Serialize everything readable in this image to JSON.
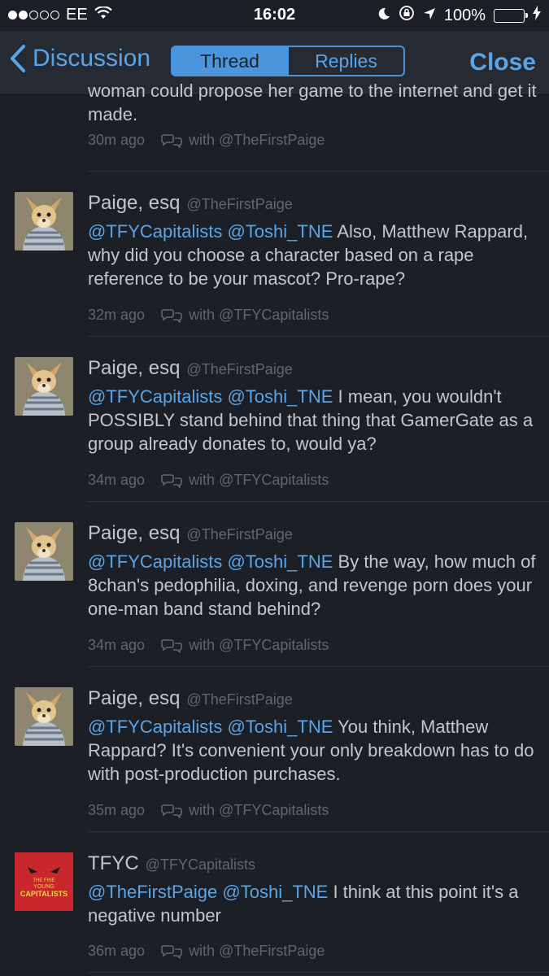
{
  "status_bar": {
    "carrier": "EE",
    "time": "16:02",
    "battery": "100%"
  },
  "nav": {
    "back_label": "Discussion",
    "tabs": [
      {
        "label": "Thread",
        "active": true
      },
      {
        "label": "Replies",
        "active": false
      }
    ],
    "close_label": "Close"
  },
  "partial_tweet": {
    "text": "woman could propose her game to the internet and get it made.",
    "time": "30m ago",
    "with": "with @TheFirstPaige"
  },
  "tweets": [
    {
      "name": "Paige, esq",
      "handle": "@TheFirstPaige",
      "mentions": "@TFYCapitalists @Toshi_TNE",
      "text": "Also, Matthew Rappard, why did you choose a character based on a rape reference to be your mascot? Pro-rape?",
      "time": "32m ago",
      "with": "with @TFYCapitalists"
    },
    {
      "name": "Paige, esq",
      "handle": "@TheFirstPaige",
      "mentions": "@TFYCapitalists @Toshi_TNE",
      "text": "I mean, you wouldn't POSSIBLY stand behind that thing that GamerGate as a group already donates to, would ya?",
      "time": "34m ago",
      "with": "with @TFYCapitalists"
    },
    {
      "name": "Paige, esq",
      "handle": "@TheFirstPaige",
      "mentions": "@TFYCapitalists @Toshi_TNE",
      "text": "By the way, how much of 8chan's pedophilia, doxing, and revenge porn does your one-man band stand behind?",
      "time": "34m ago",
      "with": "with @TFYCapitalists"
    },
    {
      "name": "Paige, esq",
      "handle": "@TheFirstPaige",
      "mentions": "@TFYCapitalists @Toshi_TNE",
      "text": "You think, Matthew Rappard? It's convenient your only breakdown has to do with post-production purchases.",
      "time": "35m ago",
      "with": "with @TFYCapitalists"
    },
    {
      "name": "TFYC",
      "handle": "@TFYCapitalists",
      "mentions": "@TheFirstPaige @Toshi_TNE",
      "text": "I think at this point it's a negative number",
      "time": "36m ago",
      "with": "with @TheFirstPaige",
      "avatar_text": [
        "THE FINE",
        "YOUNG",
        "CAPITALISTS"
      ]
    }
  ]
}
